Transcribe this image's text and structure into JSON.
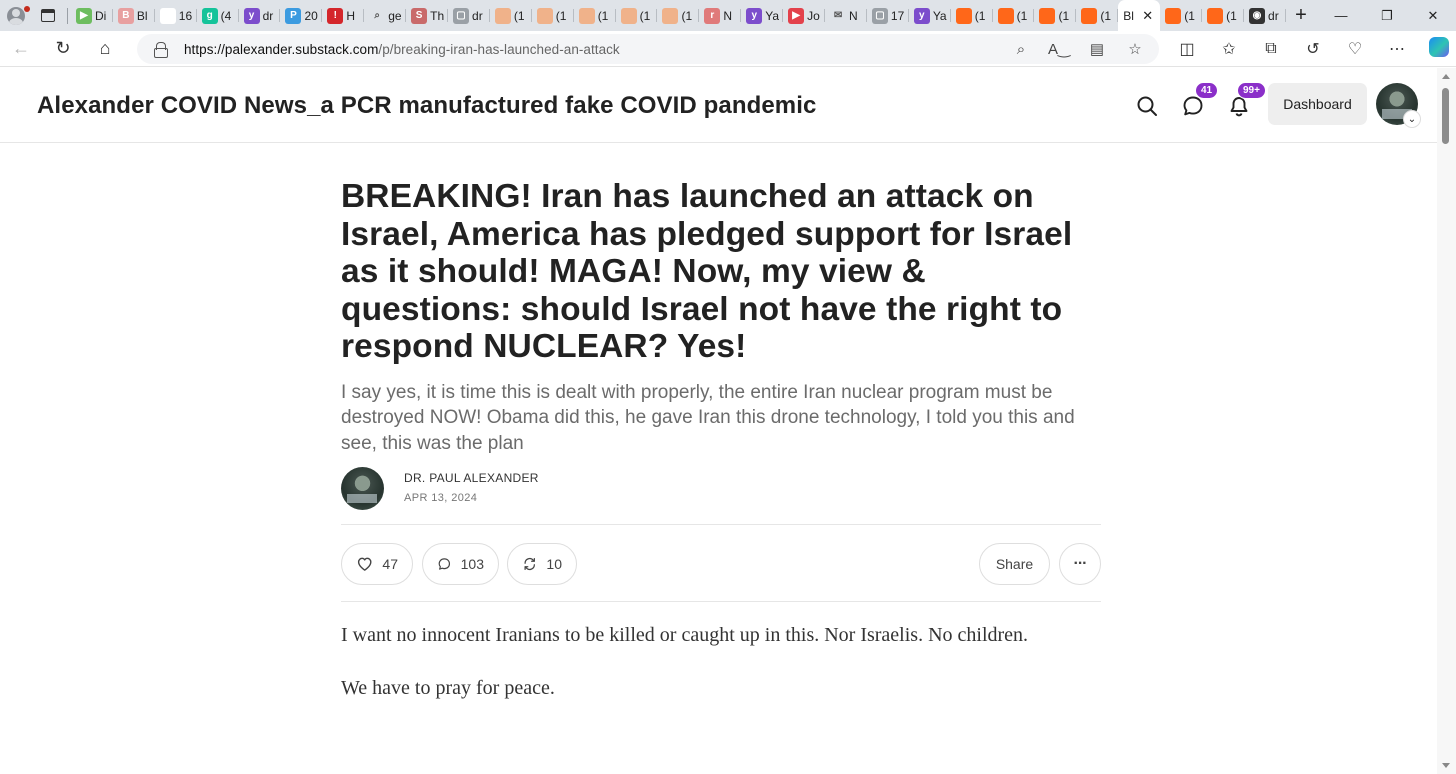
{
  "browser": {
    "tabs": [
      {
        "text": "Di",
        "fav_color": "#6dbd5f",
        "fav_glyph": "▶"
      },
      {
        "text": "Bl",
        "fav_color": "#e8a0a0",
        "fav_glyph": "B"
      },
      {
        "text": "16",
        "fav_color": "#ffffff",
        "fav_glyph": ""
      },
      {
        "text": "(4",
        "fav_color": "#15c39a",
        "fav_glyph": "g"
      },
      {
        "text": "dr",
        "fav_color": "#7c4dcc",
        "fav_glyph": "y"
      },
      {
        "text": "20",
        "fav_color": "#3c9be0",
        "fav_glyph": "P"
      },
      {
        "text": "H",
        "fav_color": "#d4262b",
        "fav_glyph": "!"
      },
      {
        "text": "ge",
        "fav_color": "#dfe3e8",
        "fav_glyph": "⌕"
      },
      {
        "text": "Th",
        "fav_color": "#c96a6a",
        "fav_glyph": "S"
      },
      {
        "text": "dr",
        "fav_color": "#9aa0a6",
        "fav_glyph": "▢"
      },
      {
        "text": "(1",
        "fav_color": "#f0b28a",
        "fav_glyph": ""
      },
      {
        "text": "(1",
        "fav_color": "#f0b28a",
        "fav_glyph": ""
      },
      {
        "text": "(1",
        "fav_color": "#f0b28a",
        "fav_glyph": ""
      },
      {
        "text": "(1",
        "fav_color": "#f0b28a",
        "fav_glyph": ""
      },
      {
        "text": "(1",
        "fav_color": "#f0b28a",
        "fav_glyph": ""
      },
      {
        "text": "N",
        "fav_color": "#e07a7a",
        "fav_glyph": "r"
      },
      {
        "text": "Ya",
        "fav_color": "#7c4dcc",
        "fav_glyph": "y"
      },
      {
        "text": "Jo",
        "fav_color": "#e3414b",
        "fav_glyph": "▶"
      },
      {
        "text": "N",
        "fav_color": "#dfe3e8",
        "fav_glyph": "✉"
      },
      {
        "text": "17",
        "fav_color": "#9aa0a6",
        "fav_glyph": "▢"
      },
      {
        "text": "Ya",
        "fav_color": "#7c4dcc",
        "fav_glyph": "y"
      },
      {
        "text": "(1",
        "fav_color": "#ff6719",
        "fav_glyph": ""
      },
      {
        "text": "(1",
        "fav_color": "#ff6719",
        "fav_glyph": ""
      },
      {
        "text": "(1",
        "fav_color": "#ff6719",
        "fav_glyph": ""
      },
      {
        "text": "(1",
        "fav_color": "#ff6719",
        "fav_glyph": ""
      },
      {
        "text": "Bl",
        "fav_color": "",
        "fav_glyph": "",
        "active": true
      },
      {
        "text": "(1",
        "fav_color": "#ff6719",
        "fav_glyph": ""
      },
      {
        "text": "(1",
        "fav_color": "#ff6719",
        "fav_glyph": ""
      },
      {
        "text": "dr",
        "fav_color": "#333333",
        "fav_glyph": "◉"
      }
    ],
    "url_host": "https://palexander.substack.com",
    "url_path": "/p/breaking-iran-has-launched-an-attack",
    "icons": {
      "profile": "profile-icon",
      "tab_actions": "tab-actions-icon",
      "back": "back-arrow-icon",
      "refresh": "refresh-icon",
      "home": "home-icon",
      "lock": "lock-icon",
      "zoom": "zoom-icon",
      "read_aloud": "read-aloud-icon",
      "immersive_reader": "immersive-reader-icon",
      "favorite": "star-icon",
      "split_screen": "split-screen-icon",
      "favorites": "favorites-icon",
      "collections": "collections-icon",
      "history": "history-icon",
      "performance": "heart-pulse-icon",
      "more": "more-icon",
      "copilot": "copilot-icon"
    },
    "colors": {
      "tabstrip": "#dfe3e8",
      "active_tab": "#ffffff",
      "substack_orange": "#ff6719"
    }
  },
  "publication": {
    "title": "Alexander COVID News_a PCR manufactured fake COVID pandemic",
    "chat_badge": "41",
    "notif_badge": "99+",
    "dashboard_label": "Dashboard",
    "badge_color": "#8b2fc9"
  },
  "post": {
    "title": "BREAKING! Iran has launched an attack on Israel, America has pledged support for Israel as it should! MAGA! Now, my view & questions: should Israel not have the right to respond NUCLEAR? Yes!",
    "subtitle": "I say yes, it is time this is dealt with properly, the entire Iran nuclear program must be destroyed NOW! Obama did this, he gave Iran this drone technology, I told you this and see, this was the plan",
    "author": "DR. PAUL ALEXANDER",
    "date": "APR 13, 2024",
    "likes": "47",
    "comments": "103",
    "restacks": "10",
    "share_label": "Share",
    "body": [
      "I want no innocent Iranians to be killed or caught up in this. Nor Israelis. No children.",
      "We have to pray for peace."
    ]
  }
}
